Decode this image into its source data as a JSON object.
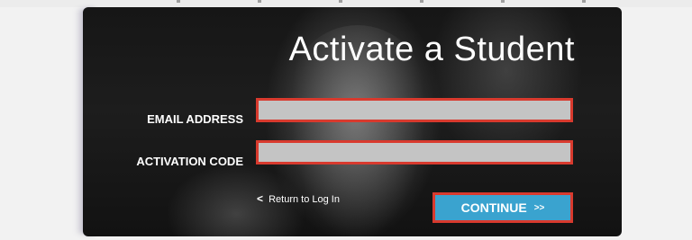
{
  "form": {
    "title": "Activate a Student",
    "email": {
      "label": "EMAIL ADDRESS",
      "value": "",
      "placeholder": ""
    },
    "activation_code": {
      "label": "ACTIVATION CODE",
      "value": "",
      "placeholder": ""
    },
    "return_link": {
      "icon": "chevron-left-icon",
      "icon_glyph": "<",
      "label": "Return to Log In"
    },
    "continue_button": {
      "label": "CONTINUE",
      "arrows": ">>"
    }
  },
  "colors": {
    "panel_background": "#1a1a1a",
    "field_background": "#c4c4c4",
    "field_border": "#d83a2e",
    "button_background": "#3aa3cf",
    "text": "#ffffff"
  }
}
